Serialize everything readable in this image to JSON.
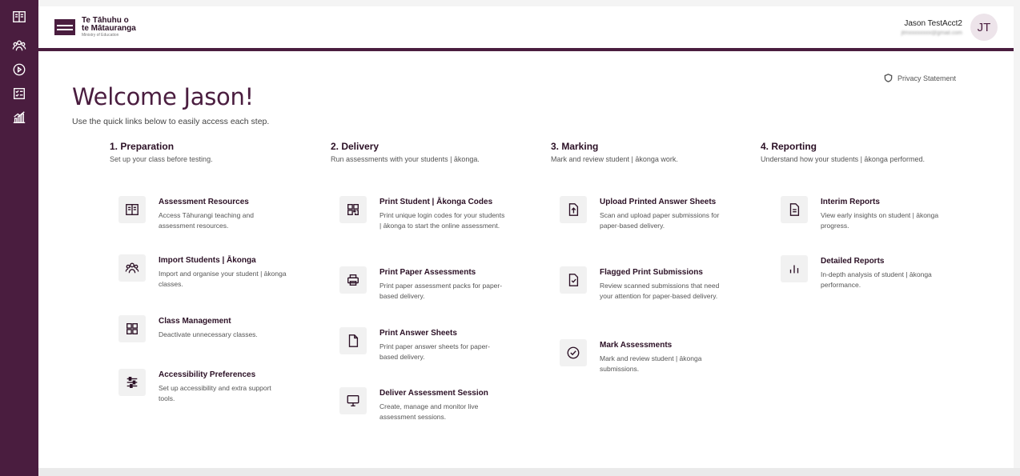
{
  "brand": {
    "line1": "Te Tāhuhu o",
    "line2": "te Mātauranga",
    "sub": "Ministry of Education"
  },
  "user": {
    "name": "Jason TestAcct2",
    "initials": "JT"
  },
  "privacy_label": "Privacy Statement",
  "welcome": {
    "title": "Welcome Jason!",
    "subtitle": "Use the quick links below to easily access each step."
  },
  "sidebar": {
    "icons": [
      "book-icon",
      "people-icon",
      "play-icon",
      "checklist-icon",
      "chart-icon"
    ]
  },
  "columns": [
    {
      "title": "1. Preparation",
      "subtitle": "Set up your class before testing.",
      "cards": [
        {
          "title": "Assessment Resources",
          "desc": "Access Tāhurangi teaching and assessment resources.",
          "icon": "book-icon"
        },
        {
          "title": "Import Students | Ākonga",
          "desc": "Import and organise your student | ākonga classes.",
          "icon": "people-icon"
        },
        {
          "title": "Class Management",
          "desc": "Deactivate unnecessary classes.",
          "icon": "grid-icon"
        },
        {
          "title": "Accessibility Preferences",
          "desc": "Set up accessibility and extra support tools.",
          "icon": "sliders-icon"
        }
      ]
    },
    {
      "title": "2. Delivery",
      "subtitle": "Run assessments with your students | ākonga.",
      "cards": [
        {
          "title": "Print Student | Ākonga Codes",
          "desc": "Print unique login codes for your students | ākonga to start the online assessment.",
          "icon": "qr-icon"
        },
        {
          "title": "Print Paper Assessments",
          "desc": "Print paper assessment packs for paper-based delivery.",
          "icon": "printer-icon"
        },
        {
          "title": "Print Answer Sheets",
          "desc": "Print paper answer sheets for paper-based delivery.",
          "icon": "document-icon"
        },
        {
          "title": "Deliver Assessment Session",
          "desc": "Create, manage and monitor live assessment sessions.",
          "icon": "monitor-icon"
        }
      ]
    },
    {
      "title": "3. Marking",
      "subtitle": "Mark and review student | ākonga work.",
      "cards": [
        {
          "title": "Upload Printed Answer Sheets",
          "desc": "Scan and upload paper submissions for paper-based delivery.",
          "icon": "upload-icon"
        },
        {
          "title": "Flagged Print Submissions",
          "desc": "Review scanned submissions that need your attention for paper-based delivery.",
          "icon": "flag-doc-icon"
        },
        {
          "title": "Mark Assessments",
          "desc": "Mark and review student | ākonga submissions.",
          "icon": "check-circle-icon"
        }
      ]
    },
    {
      "title": "4. Reporting",
      "subtitle": "Understand how your students | ākonga performed.",
      "cards": [
        {
          "title": "Interim Reports",
          "desc": "View early insights on student | ākonga progress.",
          "icon": "report-icon"
        },
        {
          "title": "Detailed Reports",
          "desc": "In-depth analysis of student | ākonga performance.",
          "icon": "bar-chart-icon"
        }
      ]
    }
  ]
}
